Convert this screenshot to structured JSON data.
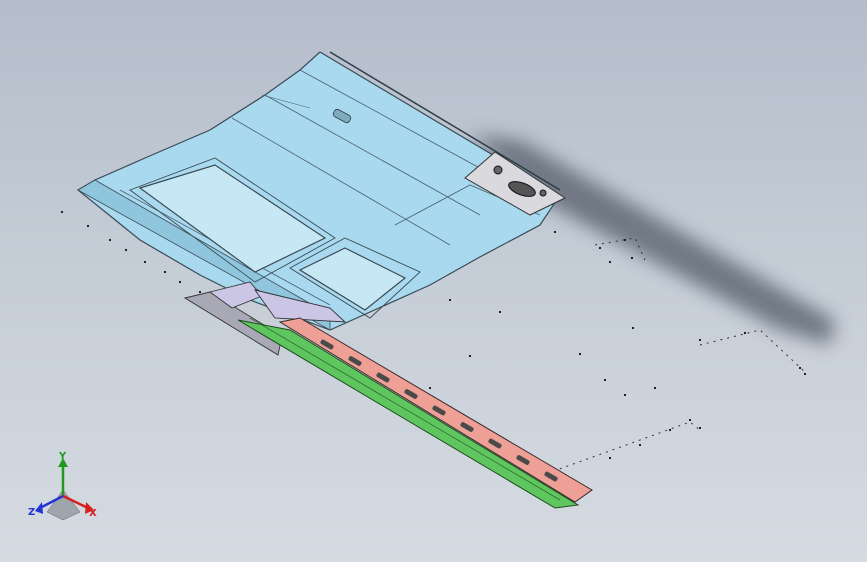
{
  "viewport": {
    "background_top": "#b4bdca",
    "background_bottom": "#d6dbe2"
  },
  "model": {
    "panel_color": "#a9d9ee",
    "rail_color": "#ee9f96",
    "strip_color": "#5fc65f",
    "bracket_color": "#d9d9de",
    "shadow_color": "#5c6470"
  },
  "triad": {
    "x_label": "X",
    "y_label": "Y",
    "z_label": "Z",
    "x_color": "#d42020",
    "y_color": "#1f9a1f",
    "z_color": "#2035d4"
  }
}
